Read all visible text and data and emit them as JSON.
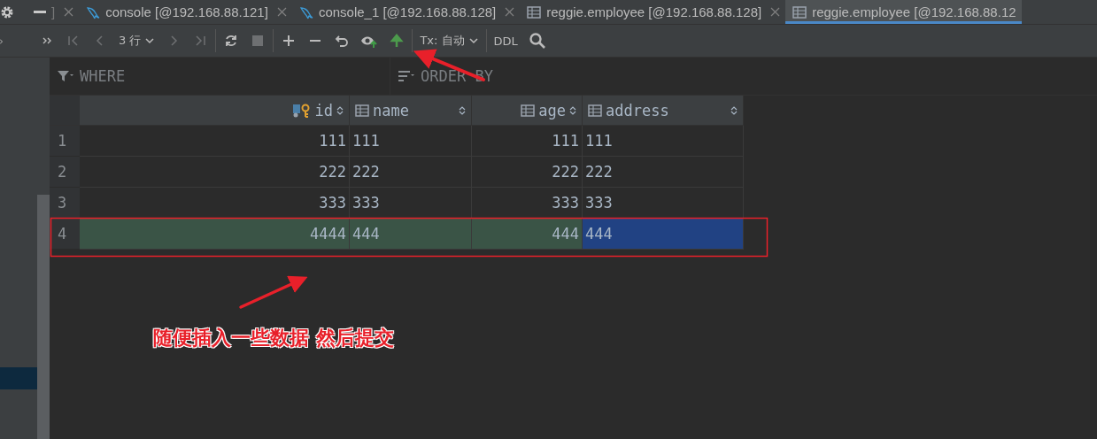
{
  "tabs": [
    {
      "label": "]",
      "kind": "partial",
      "selected": false
    },
    {
      "label": "console [@192.168.88.121]",
      "kind": "console",
      "selected": false
    },
    {
      "label": "console_1 [@192.168.88.128]",
      "kind": "console",
      "selected": false
    },
    {
      "label": "reggie.employee [@192.168.88.128]",
      "kind": "table",
      "selected": false
    },
    {
      "label": "reggie.employee [@192.168.88.12",
      "kind": "table",
      "selected": true
    }
  ],
  "toolbar": [
    {
      "kind": "more",
      "disabled": false
    },
    {
      "kind": "first",
      "disabled": true
    },
    {
      "kind": "prev",
      "disabled": true
    },
    {
      "kind": "dropdown",
      "label": "3 行",
      "disabled": false
    },
    {
      "kind": "next",
      "disabled": true
    },
    {
      "kind": "last",
      "disabled": true
    },
    {
      "kind": "sep"
    },
    {
      "kind": "refresh",
      "disabled": false
    },
    {
      "kind": "stop",
      "disabled": true
    },
    {
      "kind": "sep"
    },
    {
      "kind": "add",
      "disabled": false
    },
    {
      "kind": "remove",
      "disabled": false
    },
    {
      "kind": "revert",
      "disabled": false
    },
    {
      "kind": "preview",
      "disabled": false
    },
    {
      "kind": "submit",
      "disabled": false
    },
    {
      "kind": "sep"
    },
    {
      "kind": "dropdown",
      "label": "Tx: 自动",
      "disabled": false
    },
    {
      "kind": "sep"
    },
    {
      "kind": "text",
      "label": "DDL",
      "disabled": false
    },
    {
      "kind": "search",
      "disabled": false
    }
  ],
  "filter": {
    "where": "WHERE",
    "order_by": "ORDER BY"
  },
  "table": {
    "columns": [
      {
        "name": "id",
        "key": true
      },
      {
        "name": "name",
        "key": false
      },
      {
        "name": "age",
        "key": false
      },
      {
        "name": "address",
        "key": false
      }
    ],
    "rows": [
      {
        "number": "1",
        "inserted": false,
        "cells": [
          {
            "value": "111",
            "selected": false
          },
          {
            "value": "111",
            "selected": false
          },
          {
            "value": "111",
            "selected": false
          },
          {
            "value": "111",
            "selected": false
          }
        ]
      },
      {
        "number": "2",
        "inserted": false,
        "cells": [
          {
            "value": "222",
            "selected": false
          },
          {
            "value": "222",
            "selected": false
          },
          {
            "value": "222",
            "selected": false
          },
          {
            "value": "222",
            "selected": false
          }
        ]
      },
      {
        "number": "3",
        "inserted": false,
        "cells": [
          {
            "value": "333",
            "selected": false
          },
          {
            "value": "333",
            "selected": false
          },
          {
            "value": "333",
            "selected": false
          },
          {
            "value": "333",
            "selected": false
          }
        ]
      },
      {
        "number": "4",
        "inserted": true,
        "cells": [
          {
            "value": "4444",
            "selected": false
          },
          {
            "value": "444",
            "selected": false
          },
          {
            "value": "444",
            "selected": false
          },
          {
            "value": "444",
            "selected": true
          }
        ]
      }
    ]
  },
  "annotation": {
    "note": "随便插入一些数据 然后提交"
  }
}
